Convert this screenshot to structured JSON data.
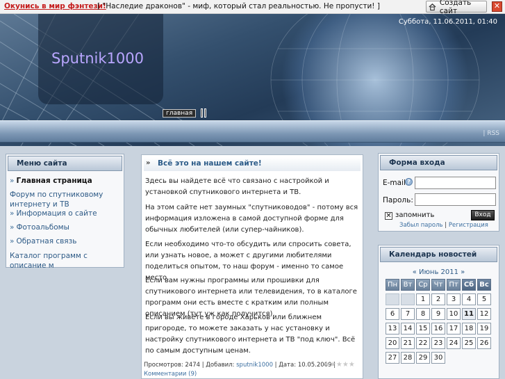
{
  "topbar": {
    "promo_link": "Окунись в мир фэнтези!",
    "promo_text": "[ \"Наследие драконов\" - миф, который стал реальностью. Не пропусти! ]",
    "create_site_label": "Создать сайт",
    "close_label": "✕"
  },
  "header": {
    "site_title": "Sputnik1000",
    "datetime": "Суббота, 11.06.2011, 01:40",
    "nav_main": "главная",
    "rss": "| RSS"
  },
  "menu": {
    "title": "Меню сайта",
    "items": [
      {
        "bullet": "»",
        "label": "Главная страница"
      },
      {
        "bullet": "",
        "label": "Форум по спутниковому интернету и ТВ"
      },
      {
        "bullet": "»",
        "label": "Информация о сайте"
      },
      {
        "bullet": "»",
        "label": "Фотоальбомы"
      },
      {
        "bullet": "»",
        "label": "Обратная связь"
      },
      {
        "bullet": "",
        "label": "Каталог программ с описание м"
      }
    ]
  },
  "post": {
    "arrows": "»",
    "title": "Всё это на нашем сайте!",
    "paragraphs": [
      "Здесь вы найдете всё что связано с настройкой и установкой спутникового интернета и ТВ.",
      "На этом сайте нет заумных \"спутниководов\" - потому вся информация изложена в самой доступной форме для обычных любителей (или супер-чайников).",
      "Если необходимо что-то обсудить или спросить совета, или узнать новое, а может с другими любителями поделиться опытом, то наш форум - именно то самое место.",
      "Если вам нужны программы или прошивки для спутникового интернета или телевидения, то в каталоге программ они есть вместе с кратким или полным описанием (тут уж как получится).",
      "Если вы живёте в городе Харьков или ближнем пригороде, то можете заказать у нас установку и настройку спутникового интернета и ТВ \"под ключ\". Всё по самым доступным ценам."
    ],
    "footer_views": "Просмотров: 2474 | Добавил: ",
    "footer_author": "sputnik1000",
    "footer_date": " | Дата: 10.05.2009 |",
    "footer_comments": "Комментарии (9)",
    "rating_stars": "★★★★★"
  },
  "login": {
    "title": "Форма входа",
    "email_label": "E-mail:",
    "password_label": "Пароль:",
    "remember_label": "запомнить",
    "remember_mark": "✕",
    "submit_label": "Вход",
    "forgot_link": "Забыл пароль",
    "separator": " | ",
    "register_link": "Регистрация",
    "info_mark": "?"
  },
  "calendar": {
    "title": "Календарь новостей",
    "month": "« Июнь 2011 »",
    "weekdays": [
      "Пн",
      "Вт",
      "Ср",
      "Чт",
      "Пт",
      "Сб",
      "Вс"
    ],
    "leading_empty": 2,
    "days": 30,
    "today": 11
  },
  "colors": {
    "accent": "#2d5a86",
    "promo": "#c41a1a",
    "title": "#b9a6ff"
  }
}
